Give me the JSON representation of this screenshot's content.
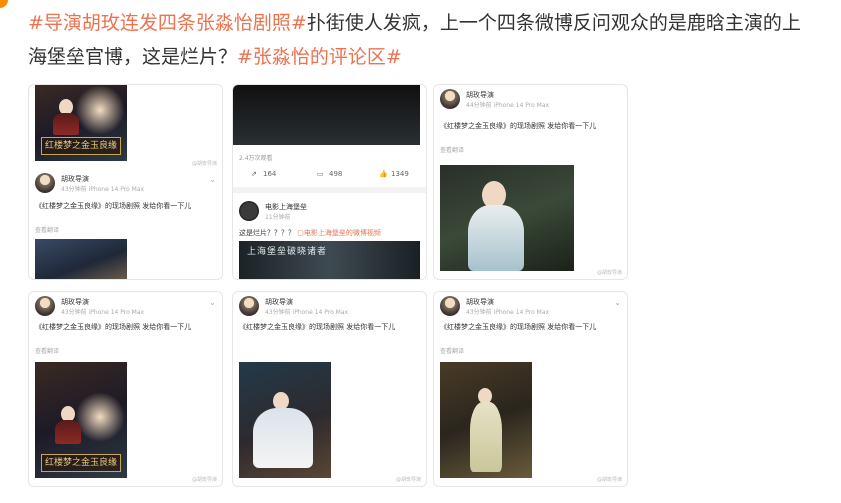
{
  "post": {
    "tag1": "#导演胡玫连发四条张淼怡剧照#",
    "body": "扑街使人发疯，上一个四条微博反问观众的是鹿晗主演的上海堡垒官博，这是烂片？",
    "tag2": "#张淼怡的评论区#"
  },
  "thumbs": {
    "t1": {
      "poster_title": "红楼梦之金玉良缘",
      "user": "胡玫导演",
      "meta": "43分钟前 iPhone 14 Pro Max",
      "text": "《红楼梦之金玉良缘》的现场剧照 发给你看一下儿",
      "translate": "查看翻译",
      "watermark": "@胡玫导演"
    },
    "t2": {
      "views": "2.4万次观看",
      "repost_icon": "repost-icon",
      "reposts": "164",
      "comments": "498",
      "likes": "1349",
      "user": "电影上海堡垒",
      "meta": "11分钟前",
      "text": "这是烂片？？？？",
      "video_link": "电影上海堡垒的微博视频",
      "video_caption": "上海堡垒破晓诸者"
    },
    "t3": {
      "user": "胡玫导演",
      "meta": "44分钟前 iPhone 14 Pro Max",
      "text": "《红楼梦之金玉良缘》的现场剧照 发给你看一下儿",
      "translate": "查看翻译",
      "watermark": "@胡玫导演"
    },
    "t4": {
      "user": "胡玫导演",
      "meta": "43分钟前 iPhone 14 Pro Max",
      "text": "《红楼梦之金玉良缘》的现场剧照 发给你看一下儿",
      "translate": "查看翻译",
      "poster_title": "红楼梦之金玉良缘",
      "watermark": "@胡玫导演"
    },
    "t5": {
      "user": "胡玫导演",
      "meta": "43分钟前 iPhone 14 Pro Max",
      "text": "《红楼梦之金玉良缘》的现场剧照 发给你看一下儿",
      "watermark": "@胡玫导演"
    },
    "t6": {
      "user": "胡玫导演",
      "meta": "43分钟前 iPhone 14 Pro Max",
      "text": "《红楼梦之金玉良缘》的现场剧照 发给你看一下儿",
      "translate": "查看翻译",
      "watermark": "@胡玫导演"
    }
  },
  "colors": {
    "tag": "#eb7350",
    "text": "#333333",
    "meta": "#aaaaaa",
    "accent_dot": "#ff8a00"
  }
}
